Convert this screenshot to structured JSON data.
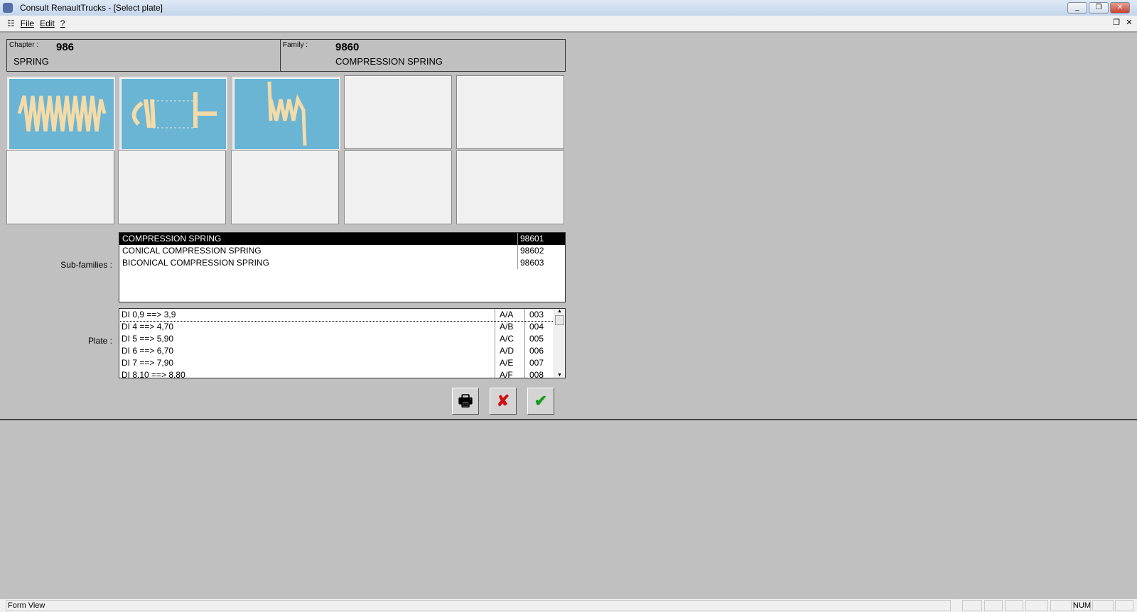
{
  "window": {
    "title": "Consult RenaultTrucks - [Select plate]"
  },
  "menu": [
    "File",
    "Edit",
    "?"
  ],
  "header": {
    "chapter_label": "Chapter :",
    "chapter_code": "986",
    "chapter_name": "SPRING",
    "family_label": "Family :",
    "family_code": "9860",
    "family_name": "COMPRESSION SPRING"
  },
  "subfamilies": {
    "label": "Sub-families :",
    "items": [
      {
        "name": "COMPRESSION SPRING",
        "code": "98601",
        "selected": true
      },
      {
        "name": "CONICAL COMPRESSION SPRING",
        "code": "98602"
      },
      {
        "name": "BICONICAL COMPRESSION SPRING",
        "code": "98603"
      }
    ]
  },
  "plate": {
    "label": "Plate :",
    "items": [
      {
        "name": "DI 0,9 ==> 3,9",
        "ref": "A/A",
        "num": "003"
      },
      {
        "name": "DI 4 ==> 4,70",
        "ref": "A/B",
        "num": "004"
      },
      {
        "name": "DI 5 ==> 5,90",
        "ref": "A/C",
        "num": "005"
      },
      {
        "name": "DI 6 ==> 6,70",
        "ref": "A/D",
        "num": "006"
      },
      {
        "name": "DI 7 ==> 7,90",
        "ref": "A/E",
        "num": "007"
      },
      {
        "name": "DI 8,10 ==> 8,80",
        "ref": "A/F",
        "num": "008"
      }
    ]
  },
  "status": {
    "text": "Form View",
    "num": "NUM"
  }
}
